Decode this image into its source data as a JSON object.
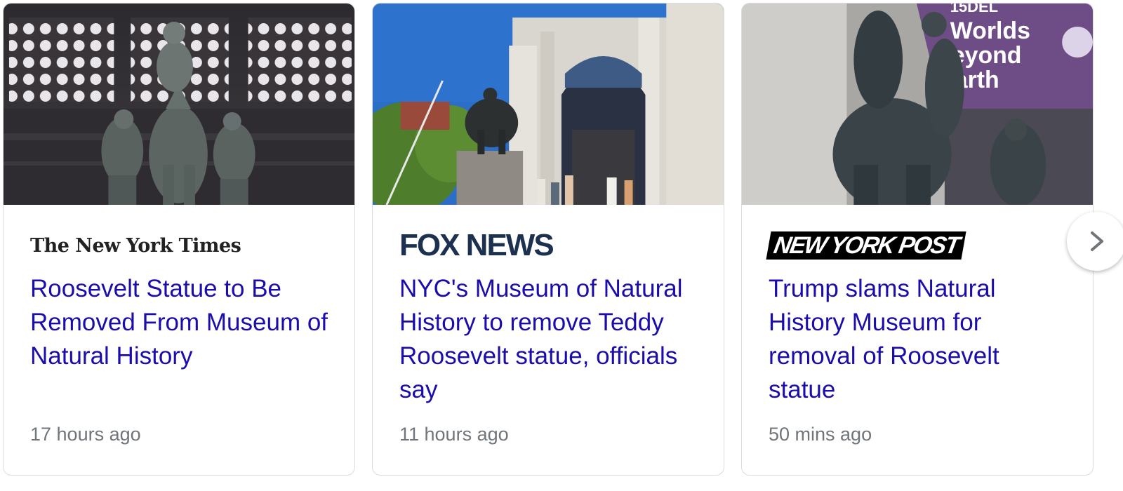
{
  "cards": [
    {
      "publisher": "The New York Times",
      "headline": "Roosevelt Statue to Be Removed From Museum of Natural History",
      "time": "17 hours ago"
    },
    {
      "publisher": "FOX NEWS",
      "headline": "NYC's Museum of Natural History to remove Teddy Roosevelt statue, officials say",
      "time": "11 hours ago"
    },
    {
      "publisher": "NEW YORK POST",
      "headline": "Trump slams Natural History Museum for removal of Roosevelt statue",
      "time": "50 mins ago"
    }
  ],
  "thumbnails": {
    "card3_banner_text": [
      "15DEL",
      "Worlds",
      "eyond",
      "arth"
    ]
  },
  "icons": {
    "next": "chevron-right-icon"
  },
  "colors": {
    "headline": "#1a0dab",
    "timestamp": "#70757a",
    "card_border": "#dadce0",
    "fox_brand": "#1c3150"
  }
}
